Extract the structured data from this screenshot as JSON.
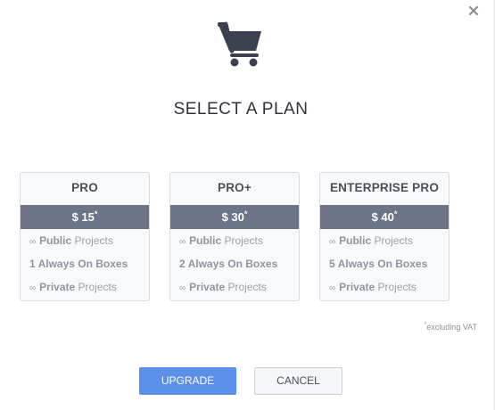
{
  "dialog": {
    "title": "SELECT A PLAN",
    "close_icon": "close-icon",
    "header_icon": "shopping-cart-icon"
  },
  "plans": [
    {
      "name": "PRO",
      "price": "$ 15",
      "price_marker": "*",
      "features": [
        {
          "prefix": "∞",
          "bold": "Public",
          "text": " Projects"
        },
        {
          "prefix": "",
          "bold": "1 Always On Boxes",
          "text": ""
        },
        {
          "prefix": "∞",
          "bold": "Private",
          "text": " Projects"
        }
      ]
    },
    {
      "name": "PRO+",
      "price": "$ 30",
      "price_marker": "*",
      "features": [
        {
          "prefix": "∞",
          "bold": "Public",
          "text": " Projects"
        },
        {
          "prefix": "",
          "bold": "2 Always On Boxes",
          "text": ""
        },
        {
          "prefix": "∞",
          "bold": "Private",
          "text": " Projects"
        }
      ]
    },
    {
      "name": "ENTERPRISE PRO",
      "price": "$ 40",
      "price_marker": "*",
      "features": [
        {
          "prefix": "∞",
          "bold": "Public",
          "text": " Projects"
        },
        {
          "prefix": "",
          "bold": "5 Always On Boxes",
          "text": ""
        },
        {
          "prefix": "∞",
          "bold": "Private",
          "text": " Projects"
        }
      ]
    }
  ],
  "vat_note": {
    "marker": "*",
    "text": "excluding VAT"
  },
  "buttons": {
    "upgrade": "UPGRADE",
    "cancel": "CANCEL"
  },
  "colors": {
    "accent": "#5b8fe8",
    "price_bar": "#6e7488",
    "card_bg": "#f8f9fa",
    "icon": "#3c4150"
  }
}
